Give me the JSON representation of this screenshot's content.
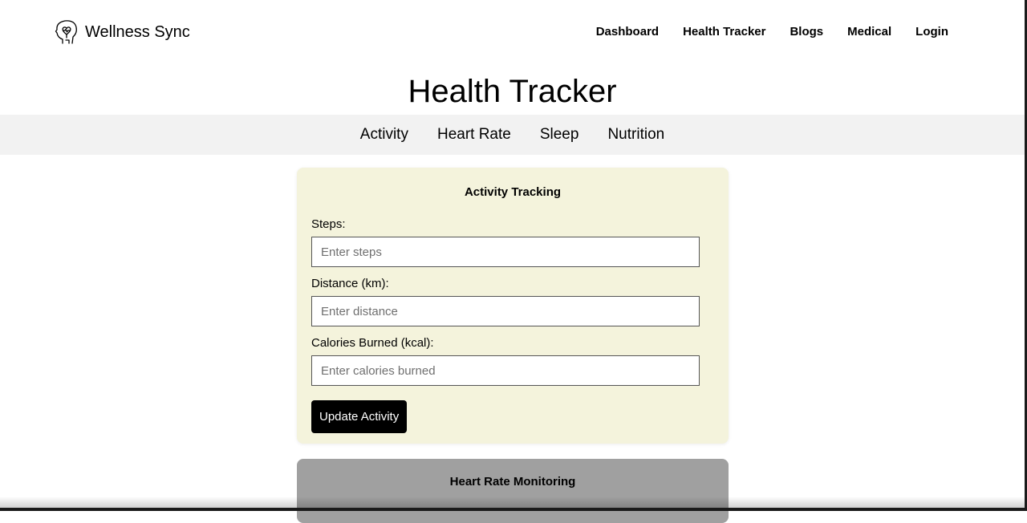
{
  "header": {
    "brand": "Wellness Sync",
    "logo_icon": "head-heart-icon",
    "nav": [
      "Dashboard",
      "Health Tracker",
      "Blogs",
      "Medical",
      "Login"
    ]
  },
  "page": {
    "title": "Health Tracker"
  },
  "tabs": [
    "Activity",
    "Heart Rate",
    "Sleep",
    "Nutrition"
  ],
  "activity": {
    "title": "Activity Tracking",
    "steps": {
      "label": "Steps:",
      "placeholder": "Enter steps",
      "value": ""
    },
    "distance": {
      "label": "Distance (km):",
      "placeholder": "Enter distance",
      "value": ""
    },
    "calories": {
      "label": "Calories Burned (kcal):",
      "placeholder": "Enter calories burned",
      "value": ""
    },
    "button": "Update Activity"
  },
  "heart_rate": {
    "title": "Heart Rate Monitoring"
  },
  "colors": {
    "activity_card": "#f4f3dc",
    "heart_card": "#a0a0a0",
    "tab_bar": "#f2f2f2",
    "button": "#000000"
  }
}
